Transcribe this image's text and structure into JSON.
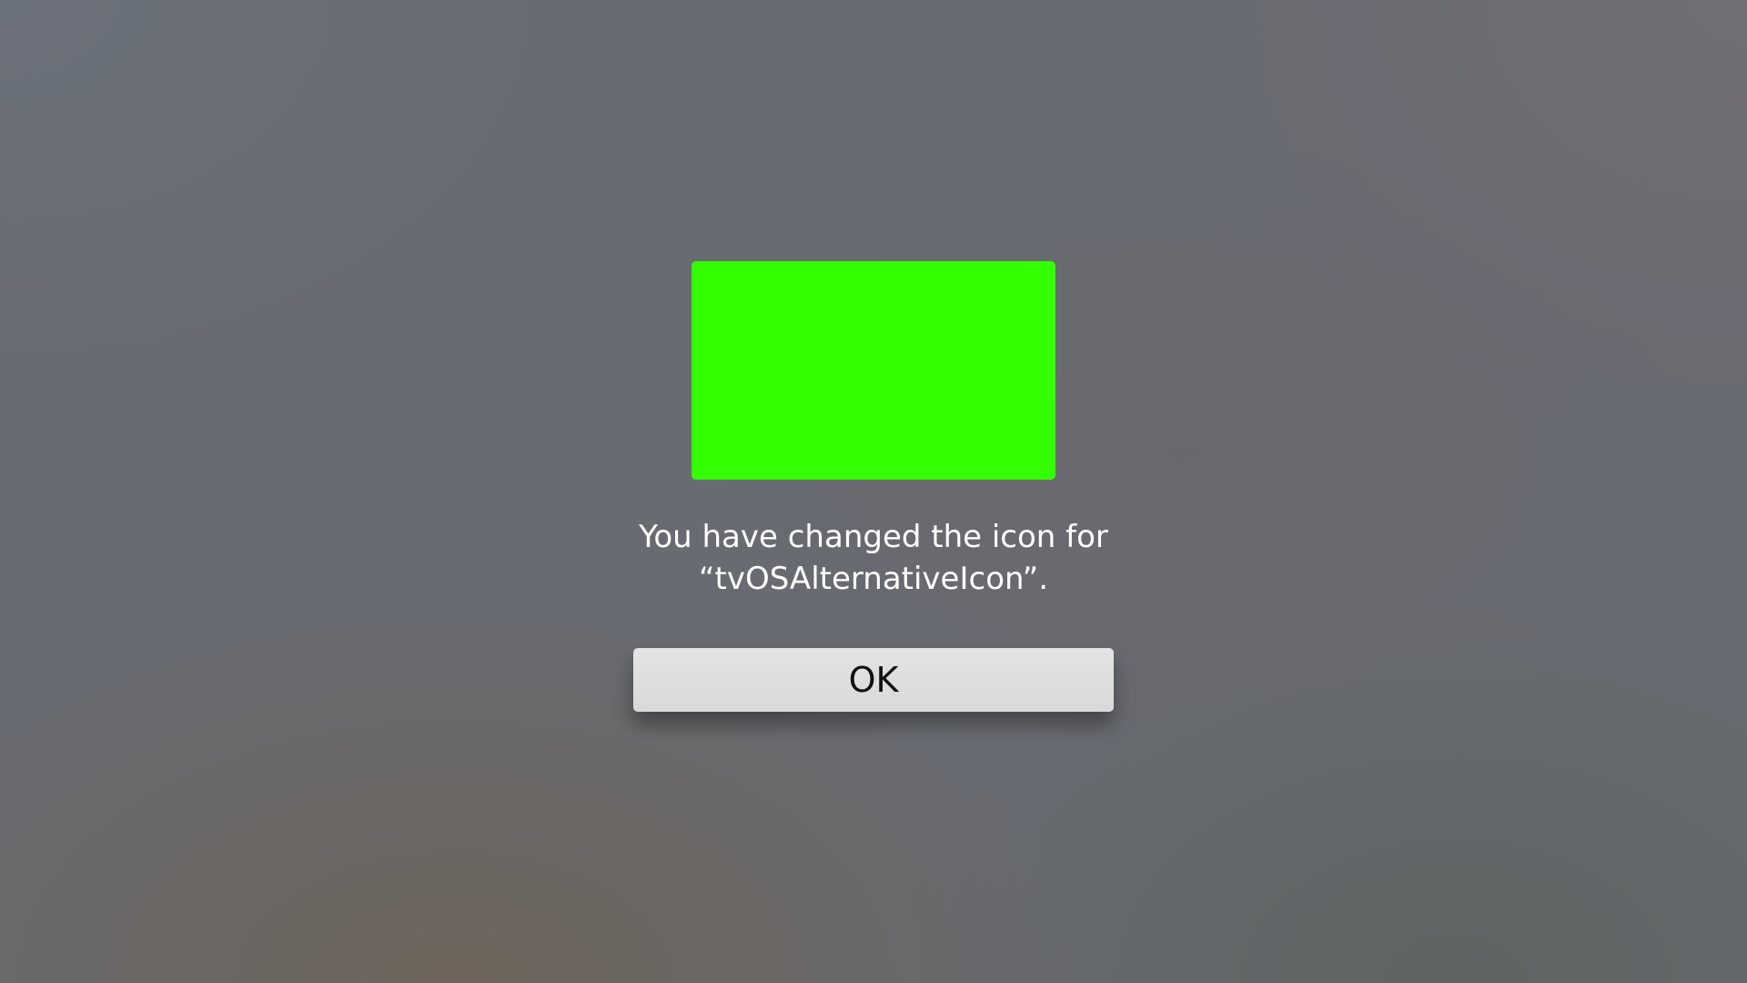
{
  "alert": {
    "icon": {
      "name": "alternative-icon-preview",
      "color": "#33ff00"
    },
    "message_line1": "You have changed the icon for",
    "message_line2": "“tvOSAlternativeIcon”.",
    "ok_label": "OK"
  }
}
